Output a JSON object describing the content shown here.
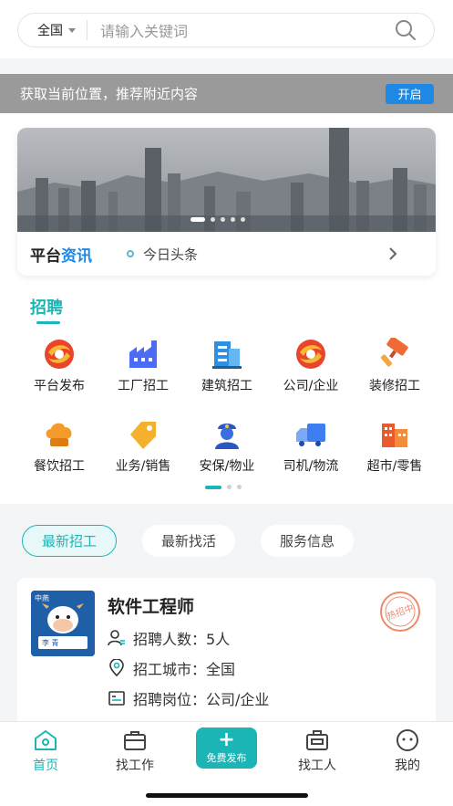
{
  "search": {
    "region": "全国",
    "placeholder": "请输入关键词"
  },
  "location_banner": {
    "text": "获取当前位置，推荐附近内容",
    "button": "开启"
  },
  "news": {
    "logo_black": "平台",
    "logo_blue": "资讯",
    "headline": "今日头条"
  },
  "recruit": {
    "title": "招聘",
    "categories": [
      {
        "label": "平台发布",
        "icon": "platform-icon"
      },
      {
        "label": "工厂招工",
        "icon": "factory-icon"
      },
      {
        "label": "建筑招工",
        "icon": "building-icon"
      },
      {
        "label": "公司/企业",
        "icon": "company-icon"
      },
      {
        "label": "装修招工",
        "icon": "paint-roller-icon"
      },
      {
        "label": "餐饮招工",
        "icon": "chef-hat-icon"
      },
      {
        "label": "业务/销售",
        "icon": "tag-icon"
      },
      {
        "label": "安保/物业",
        "icon": "security-guard-icon"
      },
      {
        "label": "司机/物流",
        "icon": "truck-icon"
      },
      {
        "label": "超市/零售",
        "icon": "store-icon"
      }
    ]
  },
  "tabs": [
    "最新招工",
    "最新找活",
    "服务信息"
  ],
  "job": {
    "title": "软件工程师",
    "stamp": "热招中",
    "avatar_top": "中燕",
    "avatar_name": "李 青",
    "lines": [
      {
        "label": "招聘人数：",
        "value": "5人"
      },
      {
        "label": "招工城市：",
        "value": "全国"
      },
      {
        "label": "招聘岗位：",
        "value": "公司/企业"
      }
    ]
  },
  "nav": {
    "home": "首页",
    "find_job": "找工作",
    "publish": "免费发布",
    "find_worker": "找工人",
    "mine": "我的"
  },
  "colors": {
    "accent": "#1bb5b5",
    "button_blue": "#1e88e5"
  }
}
